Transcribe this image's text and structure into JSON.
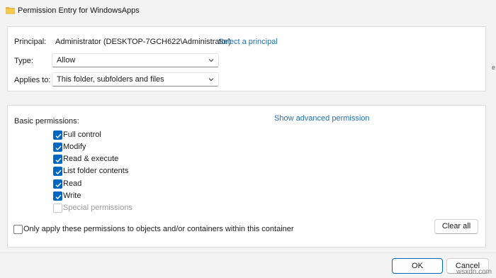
{
  "window": {
    "title": "Permission Entry for WindowsApps",
    "folder_icon": "folder-icon",
    "folder_icon_color": "#e8b738"
  },
  "principal": {
    "label": "Principal:",
    "value": "Administrator (DESKTOP-7GCH622\\Administrator)",
    "link": "Select a principal"
  },
  "type": {
    "label": "Type:",
    "value": "Allow"
  },
  "applies_to": {
    "label": "Applies to:",
    "value": "This folder, subfolders and files"
  },
  "basic_permissions": {
    "label": "Basic permissions:",
    "advanced_link": "Show advanced permission",
    "items": [
      {
        "label": "Full control",
        "checked": true,
        "disabled": false
      },
      {
        "label": "Modify",
        "checked": true,
        "disabled": false
      },
      {
        "label": "Read & execute",
        "checked": true,
        "disabled": false
      },
      {
        "label": "List folder contents",
        "checked": true,
        "disabled": false
      },
      {
        "label": "Read",
        "checked": true,
        "disabled": false
      },
      {
        "label": "Write",
        "checked": true,
        "disabled": false
      },
      {
        "label": "Special permissions",
        "checked": false,
        "disabled": true
      }
    ]
  },
  "only_apply": {
    "label": "Only apply these permissions to objects and/or containers within this container",
    "checked": false
  },
  "buttons": {
    "clear_all": "Clear all",
    "ok": "OK",
    "cancel": "Cancel"
  },
  "edge_glyph": "e",
  "watermark": "wsxdn.com",
  "colors": {
    "accent": "#0067c0",
    "link": "#1f6fb2"
  }
}
